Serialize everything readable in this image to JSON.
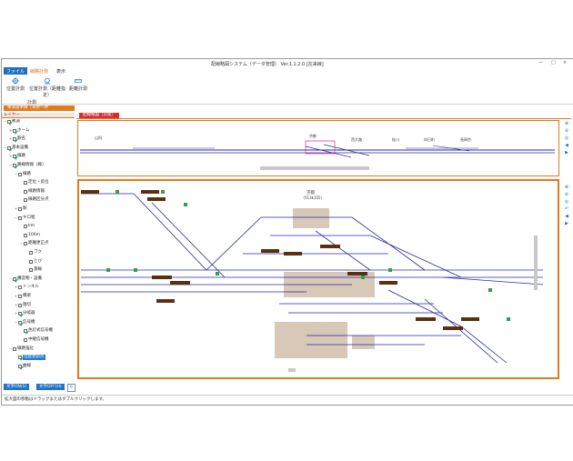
{
  "window": {
    "title": "配線略図システム（データ管理） Ver.1.1.2.0 [在来線]",
    "min_label": "—",
    "max_label": "□",
    "close_label": "×"
  },
  "menu": {
    "items": [
      "ファイル",
      "線路計測",
      "表示"
    ]
  },
  "ribbon": {
    "buttons": [
      "位置計測",
      "位置計測（距離指定）",
      "距離計測"
    ],
    "group_label": "計測"
  },
  "tabs": {
    "main_tab": "東海道本線［米原～神"
  },
  "layer_panel": {
    "header": "レイヤー",
    "nodes": [
      {
        "label": "軌道",
        "level": 0,
        "checked": true,
        "exp": "−"
      },
      {
        "label": "ホーム",
        "level": 1,
        "checked": true,
        "exp": "+"
      },
      {
        "label": "駅名",
        "level": 1,
        "checked": true,
        "exp": "+"
      },
      {
        "label": "基本設備",
        "level": 0,
        "checked": true,
        "exp": "−"
      },
      {
        "label": "線路",
        "level": 1,
        "checked": true,
        "exp": "+"
      },
      {
        "label": "路線情報（線）",
        "level": 1,
        "checked": true,
        "exp": "−"
      },
      {
        "label": "線路",
        "level": 2,
        "checked": false,
        "exp": "−"
      },
      {
        "label": "定位・反位",
        "level": 3,
        "checked": false,
        "exp": ""
      },
      {
        "label": "線路情報",
        "level": 3,
        "checked": false,
        "exp": ""
      },
      {
        "label": "線路区分点",
        "level": 3,
        "checked": false,
        "exp": ""
      },
      {
        "label": "駅",
        "level": 2,
        "checked": false,
        "exp": "+"
      },
      {
        "label": "キロ程",
        "level": 2,
        "checked": false,
        "exp": "−"
      },
      {
        "label": "km",
        "level": 3,
        "checked": false,
        "exp": ""
      },
      {
        "label": "100m",
        "level": 3,
        "checked": false,
        "exp": ""
      },
      {
        "label": "距離更正点",
        "level": 3,
        "checked": false,
        "exp": "−"
      },
      {
        "label": "ブク",
        "level": 4,
        "checked": false,
        "exp": ""
      },
      {
        "label": "とび",
        "level": 4,
        "checked": false,
        "exp": ""
      },
      {
        "label": "基線",
        "level": 4,
        "checked": false,
        "exp": ""
      },
      {
        "label": "構造物・設備",
        "level": 1,
        "checked": true,
        "exp": "−"
      },
      {
        "label": "トンネル",
        "level": 2,
        "checked": false,
        "exp": "+"
      },
      {
        "label": "橋梁",
        "level": 2,
        "checked": false,
        "exp": "+"
      },
      {
        "label": "踏切",
        "level": 2,
        "checked": false,
        "exp": "+"
      },
      {
        "label": "分岐器",
        "level": 2,
        "checked": true,
        "exp": "+"
      },
      {
        "label": "信号機",
        "level": 2,
        "checked": true,
        "exp": "−"
      },
      {
        "label": "色灯式信号機",
        "level": 3,
        "checked": true,
        "exp": ""
      },
      {
        "label": "中継信号機",
        "level": 3,
        "checked": false,
        "exp": ""
      },
      {
        "label": "線路強化",
        "level": 1,
        "checked": false,
        "exp": "−"
      },
      {
        "label": "位配更新点",
        "level": 2,
        "checked": true,
        "exp": "",
        "selected": true
      },
      {
        "label": "曲線",
        "level": 2,
        "checked": true,
        "exp": ""
      }
    ],
    "btn_text_on": "文字ON(S)",
    "btn_text_off": "文字OFF(H)"
  },
  "map": {
    "header_label": "配線略図（京阪）",
    "station_name": "京都",
    "station_km": "（513k355）",
    "overview_stations": [
      "山科",
      "京都",
      "西大路",
      "桂川",
      "向日町",
      "長岡京"
    ],
    "track_color": "#2a2aa0",
    "platform_color": "#d8c8b8",
    "label_bg": "#5a3010",
    "label_fg": "#ffd070"
  },
  "status_bar": {
    "text": "拡大図の移動はドラッグまたはダブルクリックします。"
  }
}
